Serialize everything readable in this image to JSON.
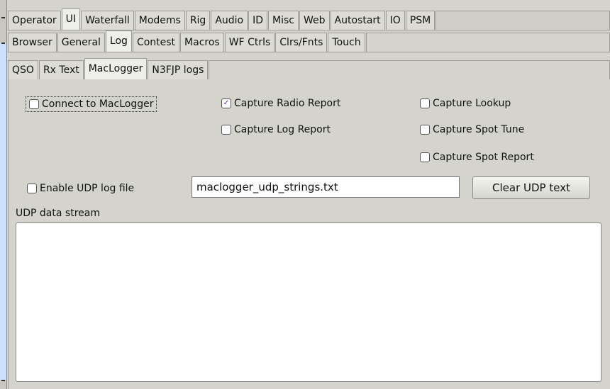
{
  "tabs": {
    "primary": [
      "Operator",
      "UI",
      "Waterfall",
      "Modems",
      "Rig",
      "Audio",
      "ID",
      "Misc",
      "Web",
      "Autostart",
      "IO",
      "PSM"
    ],
    "secondary": [
      "Browser",
      "General",
      "Log",
      "Contest",
      "Macros",
      "WF Ctrls",
      "Clrs/Fnts",
      "Touch"
    ],
    "tertiary": [
      "QSO",
      "Rx Text",
      "MacLogger",
      "N3FJP logs"
    ],
    "active_primary": "UI",
    "active_secondary": "Log",
    "active_tertiary": "MacLogger"
  },
  "maclogger": {
    "connect": {
      "label": "Connect to MacLogger",
      "checked": false
    },
    "capture_radio_report": {
      "label": "Capture Radio Report",
      "checked": true
    },
    "capture_log_report": {
      "label": "Capture Log Report",
      "checked": false
    },
    "capture_lookup": {
      "label": "Capture Lookup",
      "checked": false
    },
    "capture_spot_tune": {
      "label": "Capture Spot Tune",
      "checked": false
    },
    "capture_spot_report": {
      "label": "Capture Spot Report",
      "checked": false
    },
    "enable_udp_log": {
      "label": "Enable UDP log file",
      "checked": false
    },
    "udp_log_filename": "maclogger_udp_strings.txt",
    "clear_udp_button": "Clear UDP text",
    "udp_stream_label": "UDP data stream",
    "udp_stream_text": ""
  },
  "colors": {
    "background": "#d4d4cc",
    "active_tab": "#efefe9",
    "check_mark": "#5a2a78"
  },
  "icons": {
    "checked_mark": "✓"
  }
}
